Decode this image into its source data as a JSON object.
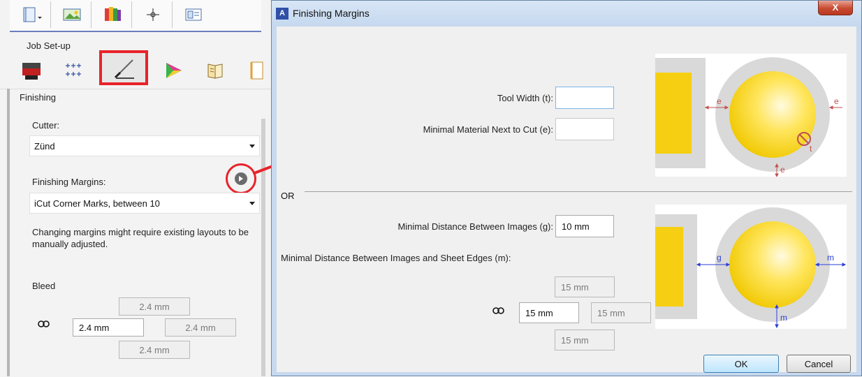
{
  "left_panel": {
    "toolbar_icons": [
      "page-icon",
      "image-icon",
      "color-swatches-icon",
      "crosshair-icon",
      "layout-icon"
    ],
    "section_label": "Job Set-up",
    "tab_icons": [
      "printer-icon",
      "crop-marks-icon",
      "finishing-knife-icon",
      "color-wedge-icon",
      "booklet-icon",
      "document-icon"
    ],
    "heading": "Finishing",
    "cutter_label": "Cutter:",
    "cutter_value": "Zünd",
    "margins_label": "Finishing Margins:",
    "margins_value": "iCut Corner Marks, between 10",
    "note": "Changing margins might require existing layouts to be manually adjusted.",
    "bleed_label": "Bleed",
    "bleed": {
      "top": "2.4 mm",
      "left": "2.4 mm",
      "right": "2.4 mm",
      "bottom": "2.4 mm"
    }
  },
  "dialog": {
    "app_icon": "A",
    "title": "Finishing Margins",
    "close_label": "X",
    "tool_width_label": "Tool Width (t):",
    "tool_width_value": "",
    "min_material_label": "Minimal Material Next to Cut (e):",
    "min_material_value": "",
    "or_label": "OR",
    "min_dist_images_label": "Minimal Distance Between Images (g):",
    "min_dist_images_value": "10 mm",
    "min_dist_edges_label": "Minimal Distance Between Images and Sheet Edges (m):",
    "edges": {
      "top": "15 mm",
      "left": "15 mm",
      "right": "15 mm",
      "bottom": "15 mm"
    },
    "ok_label": "OK",
    "cancel_label": "Cancel",
    "diagram1_labels": {
      "e1": "e",
      "e2": "e",
      "e3": "e",
      "t": "t"
    },
    "diagram2_labels": {
      "g": "g",
      "m1": "m",
      "m2": "m"
    }
  },
  "colors": {
    "highlight": "#e8232a",
    "dim_red": "#c0504d",
    "dim_blue": "#2b3fd6",
    "title_bg": "#c7d9ef"
  }
}
